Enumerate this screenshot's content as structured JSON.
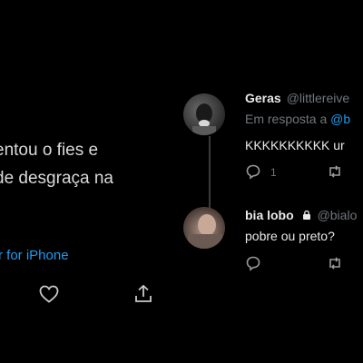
{
  "main_tweet": {
    "text_lines": [
      "entou o fies e",
      "de desgraça na"
    ],
    "source": "r for iPhone"
  },
  "replies": [
    {
      "name": "Geras",
      "handle": "@littlereive",
      "reply_prefix": "Em resposta a",
      "reply_mention": "@b",
      "text": "KKKKKKKKKK ur",
      "reply_count": "1"
    },
    {
      "name": "bia lobo",
      "handle": "@bialo",
      "text": "pobre ou preto?"
    }
  ],
  "colors": {
    "link": "#1d9bf0",
    "muted": "#71767b"
  }
}
